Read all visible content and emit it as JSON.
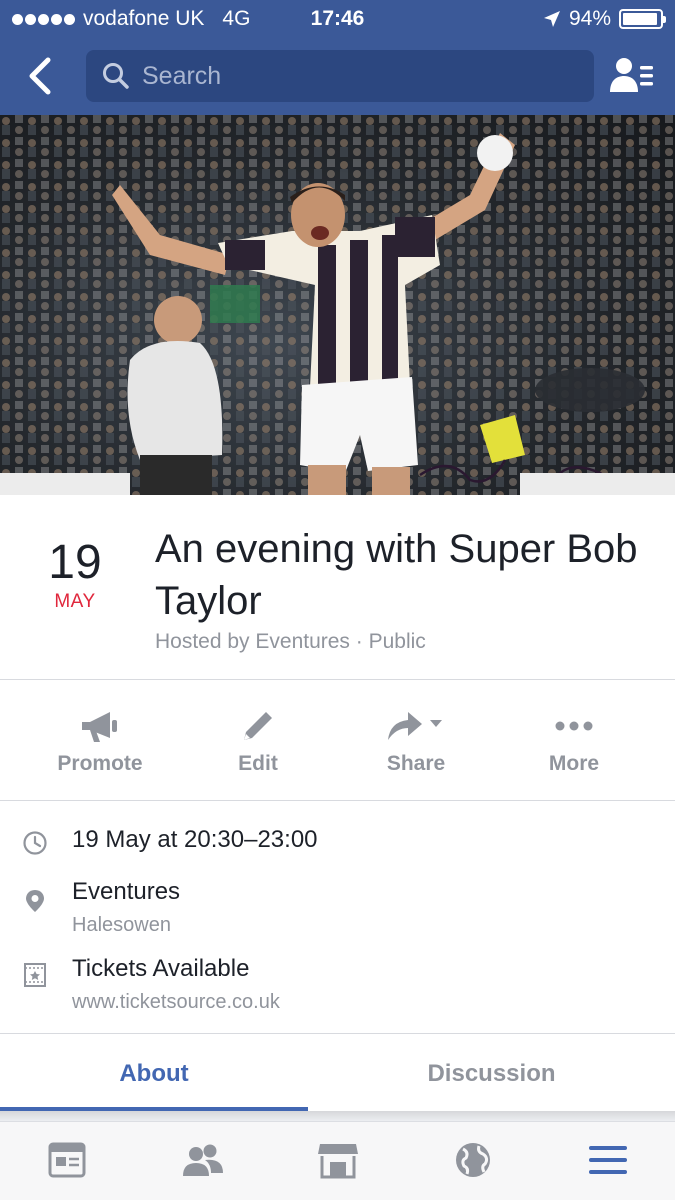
{
  "status_bar": {
    "carrier": "vodafone UK",
    "network": "4G",
    "time": "17:46",
    "battery_percent": "94%",
    "battery_level": 0.94
  },
  "nav": {
    "search_placeholder": "Search"
  },
  "event": {
    "day": "19",
    "month": "MAY",
    "title": "An evening with Super Bob Taylor",
    "host_line": "Hosted by Eventures · Public"
  },
  "actions": [
    {
      "label": "Promote",
      "icon": "megaphone-icon"
    },
    {
      "label": "Edit",
      "icon": "pencil-icon"
    },
    {
      "label": "Share",
      "icon": "share-arrow-icon"
    },
    {
      "label": "More",
      "icon": "more-dots-icon"
    }
  ],
  "details": {
    "time": "19 May at 20:30–23:00",
    "venue": "Eventures",
    "venue_location": "Halesowen",
    "tickets": "Tickets Available",
    "tickets_url": "www.ticketsource.co.uk"
  },
  "tabs": [
    {
      "label": "About",
      "active": true
    },
    {
      "label": "Discussion",
      "active": false
    }
  ],
  "tabbar": [
    "news-feed-icon",
    "friends-icon",
    "marketplace-icon",
    "notifications-globe-icon",
    "menu-icon"
  ],
  "colors": {
    "brand": "#3b5998",
    "accent": "#4267b2",
    "date_red": "#e0273c",
    "muted": "#90949c"
  }
}
